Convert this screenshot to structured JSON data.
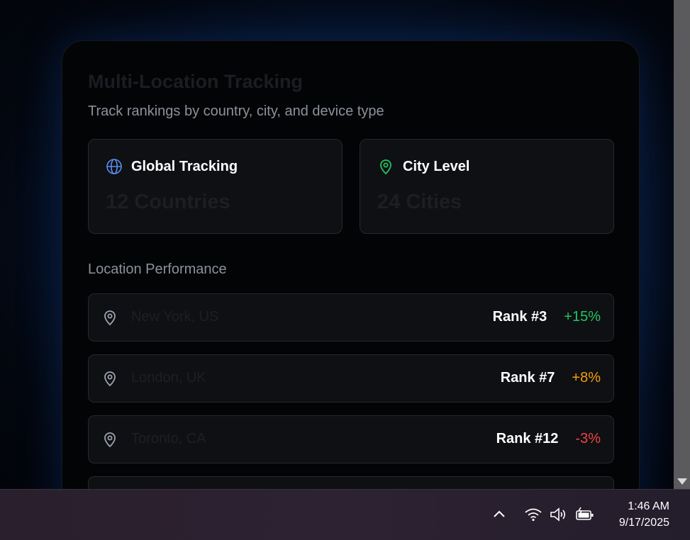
{
  "card": {
    "title": "Multi-Location Tracking",
    "subtitle": "Track rankings by country, city, and device type"
  },
  "stats": [
    {
      "label": "Global Tracking",
      "value": "12 Countries",
      "icon": "globe-icon",
      "icon_color": "#5b8def"
    },
    {
      "label": "City Level",
      "value": "24 Cities",
      "icon": "map-pin-icon",
      "icon_color": "#22c55e"
    }
  ],
  "section": {
    "title": "Location Performance"
  },
  "locations": [
    {
      "name": "New York, US",
      "rank": "Rank #3",
      "change": "+15%",
      "change_color": "#22c55e"
    },
    {
      "name": "London, UK",
      "rank": "Rank #7",
      "change": "+8%",
      "change_color": "#f59e0b"
    },
    {
      "name": "Toronto, CA",
      "rank": "Rank #12",
      "change": "-3%",
      "change_color": "#ef4444"
    }
  ],
  "taskbar": {
    "time": "1:46 AM",
    "date": "9/17/2025",
    "tray_icons": [
      "chevron-up-icon",
      "wifi-icon",
      "volume-icon",
      "battery-icon"
    ]
  }
}
